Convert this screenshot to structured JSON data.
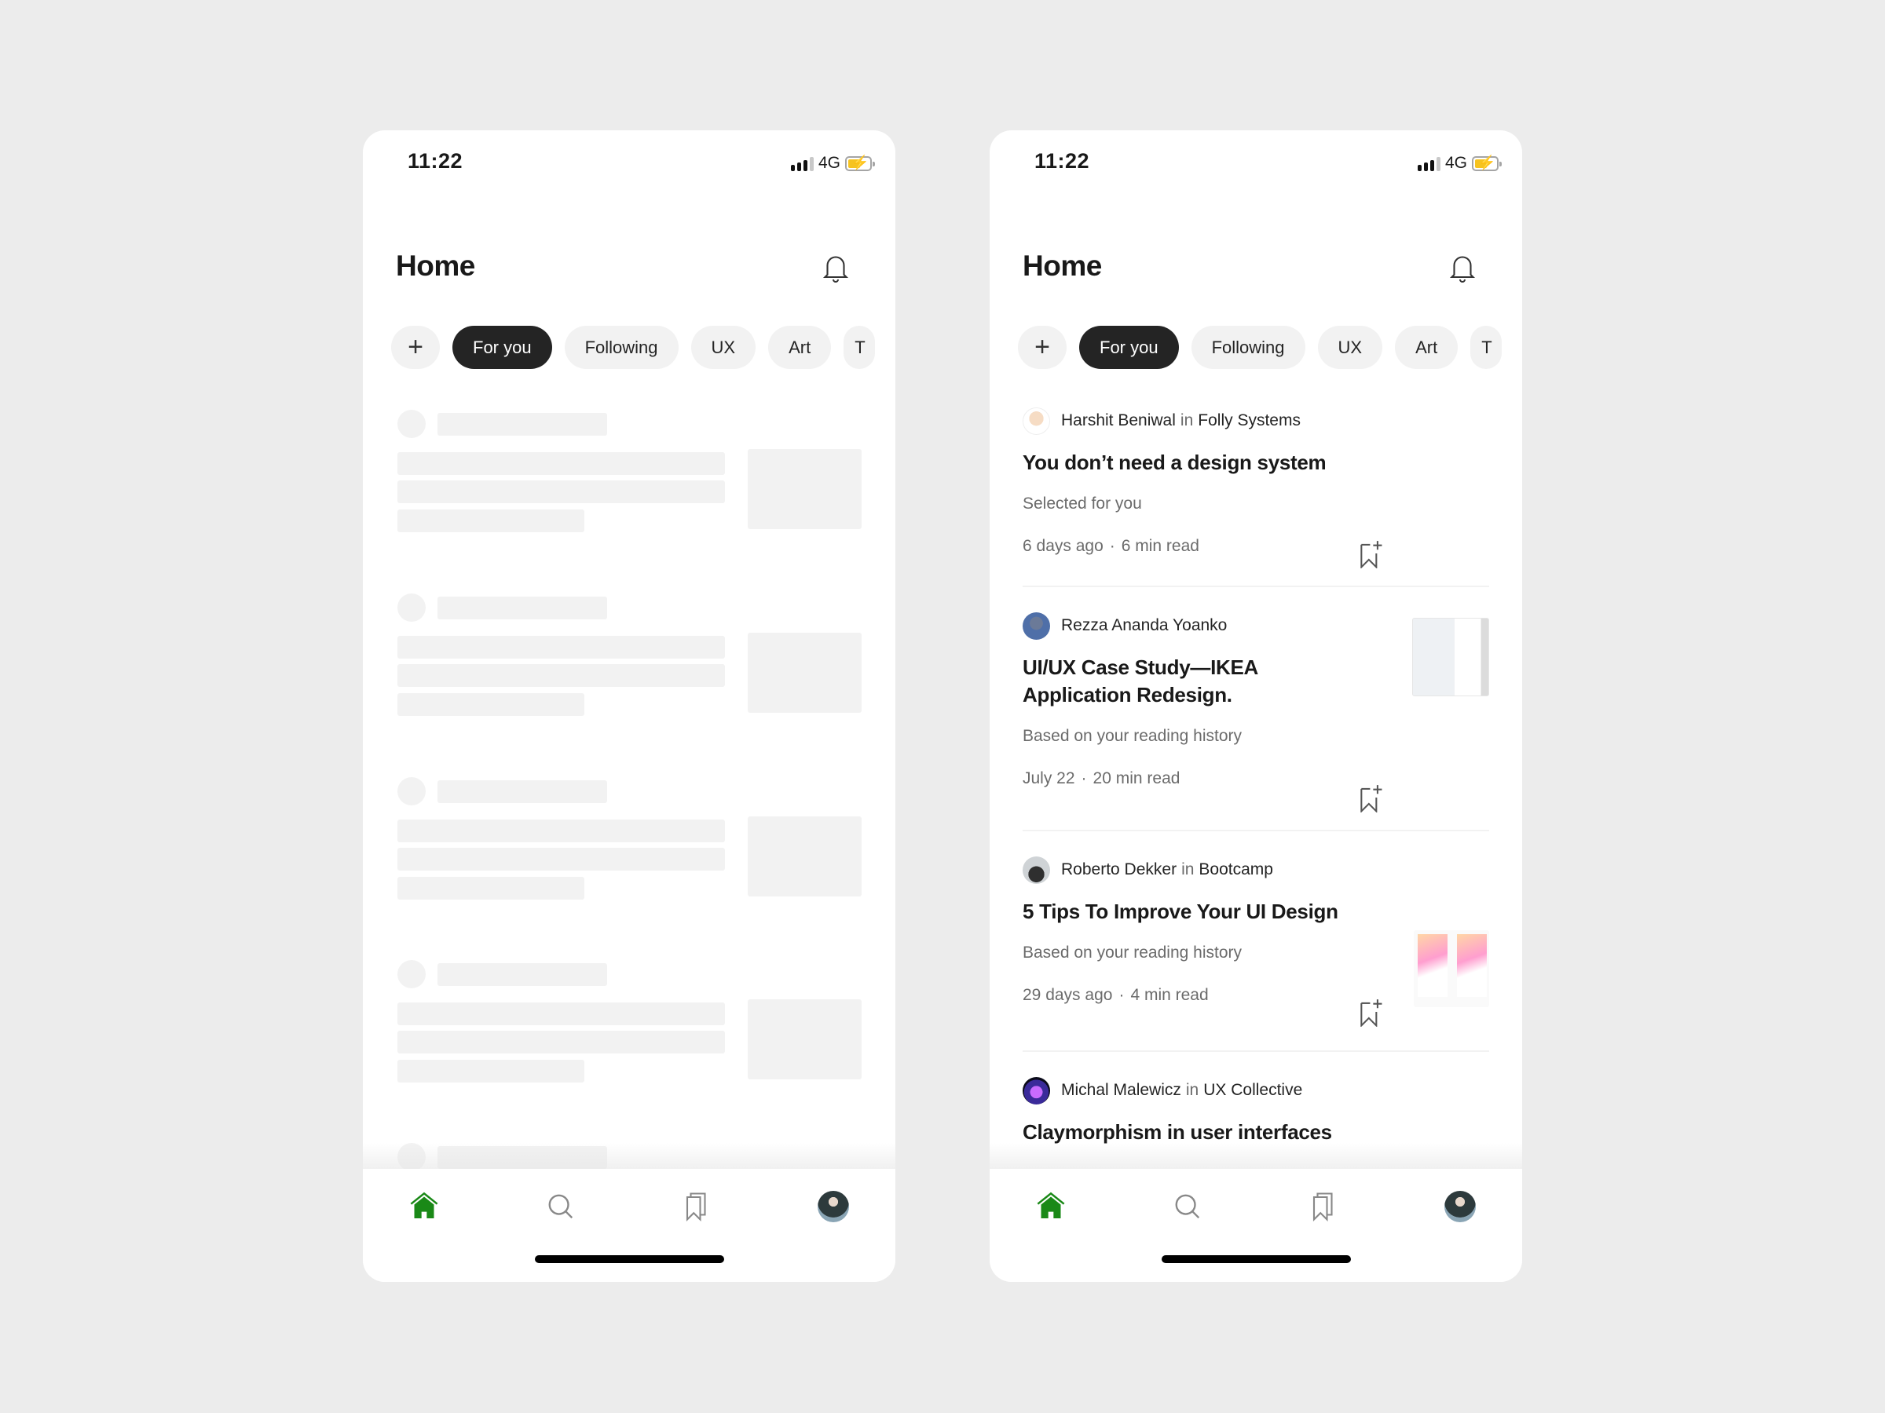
{
  "colors": {
    "accent_green": "#1a8917",
    "pill_active_bg": "#242424",
    "pill_bg": "#f2f2f2",
    "skeleton": "#f2f2f2",
    "battery_fill": "#f6c320"
  },
  "status_bar": {
    "time": "11:22",
    "network": "4G",
    "signal_icon": "signal-bars-icon",
    "battery_icon": "battery-charging-icon"
  },
  "header": {
    "title": "Home",
    "notification_icon": "bell-icon"
  },
  "topics": {
    "add_icon": "plus-icon",
    "add_label": "+",
    "items": [
      {
        "label": "For you",
        "active": true
      },
      {
        "label": "Following",
        "active": false
      },
      {
        "label": "UX",
        "active": false
      },
      {
        "label": "Art",
        "active": false
      },
      {
        "label": "T",
        "active": false
      }
    ]
  },
  "loading_screen": {
    "state": "skeleton",
    "placeholder_count": 5
  },
  "feed": {
    "in_word": "in",
    "dot": "·",
    "articles": [
      {
        "author": "Harshit Beniwal",
        "publication": "Folly Systems",
        "title": "You don’t need a design system",
        "reason": "Selected for you",
        "date": "6 days ago",
        "read_time": "6 min read"
      },
      {
        "author": "Rezza Ananda Yoanko",
        "publication": "",
        "title": "UI/UX Case Study—IKEA Application Redesign.",
        "reason": "Based on your reading history",
        "date": "July 22",
        "read_time": "20 min read"
      },
      {
        "author": "Roberto Dekker",
        "publication": "Bootcamp",
        "title": "5 Tips To Improve Your UI Design",
        "reason": "Based on your reading history",
        "date": "29 days ago",
        "read_time": "4 min read"
      },
      {
        "author": "Michal Malewicz",
        "publication": "UX Collective",
        "title": "Claymorphism in user interfaces"
      }
    ]
  },
  "tab_bar": {
    "items": [
      {
        "icon": "home-icon",
        "active": true
      },
      {
        "icon": "search-icon",
        "active": false
      },
      {
        "icon": "bookmarks-icon",
        "active": false
      },
      {
        "icon": "profile-avatar",
        "active": false
      }
    ]
  }
}
